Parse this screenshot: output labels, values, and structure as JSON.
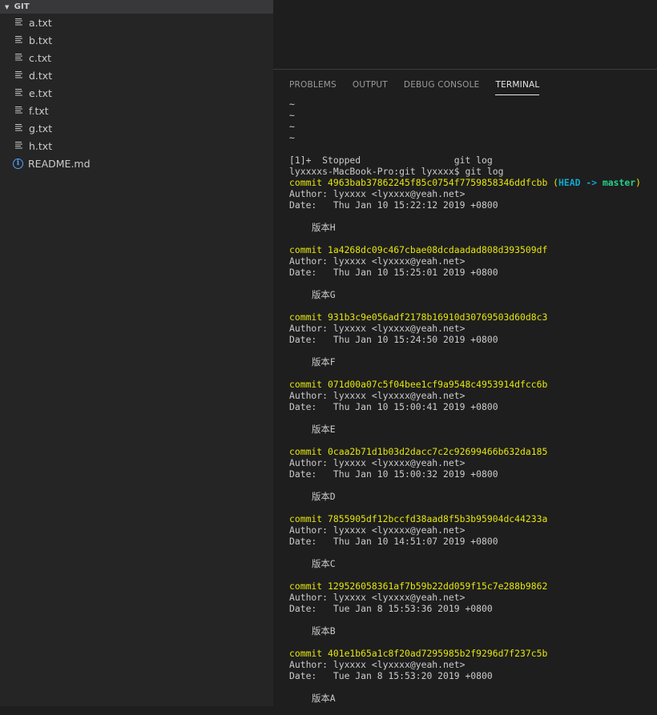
{
  "explorer": {
    "section_title": "GIT",
    "files": [
      {
        "name": "a.txt",
        "icon": "lines-file-icon"
      },
      {
        "name": "b.txt",
        "icon": "lines-file-icon"
      },
      {
        "name": "c.txt",
        "icon": "lines-file-icon"
      },
      {
        "name": "d.txt",
        "icon": "lines-file-icon"
      },
      {
        "name": "e.txt",
        "icon": "lines-file-icon"
      },
      {
        "name": "f.txt",
        "icon": "lines-file-icon"
      },
      {
        "name": "g.txt",
        "icon": "lines-file-icon"
      },
      {
        "name": "h.txt",
        "icon": "lines-file-icon"
      },
      {
        "name": "README.md",
        "icon": "info-icon"
      }
    ]
  },
  "panel": {
    "tabs": [
      "PROBLEMS",
      "OUTPUT",
      "DEBUG CONSOLE",
      "TERMINAL"
    ],
    "active_tab": "TERMINAL"
  },
  "terminal": {
    "tildes": [
      "~",
      "~",
      "~",
      "~"
    ],
    "stopped_line": "[1]+  Stopped                 git log",
    "prompt_line": "lyxxxxs-MacBook-Pro:git lyxxxx$ git log",
    "commits": [
      {
        "commit": "commit 4963bab37862245f85c0754f7759858346ddfcbb",
        "head": "HEAD ->",
        "branch": "master",
        "author": "Author: lyxxxx <lyxxxx@yeah.net>",
        "date": "Date:   Thu Jan 10 15:22:12 2019 +0800",
        "message": "版本H"
      },
      {
        "commit": "commit 1a4268dc09c467cbae08dcdaadad808d393509df",
        "author": "Author: lyxxxx <lyxxxx@yeah.net>",
        "date": "Date:   Thu Jan 10 15:25:01 2019 +0800",
        "message": "版本G"
      },
      {
        "commit": "commit 931b3c9e056adf2178b16910d30769503d60d8c3",
        "author": "Author: lyxxxx <lyxxxx@yeah.net>",
        "date": "Date:   Thu Jan 10 15:24:50 2019 +0800",
        "message": "版本F"
      },
      {
        "commit": "commit 071d00a07c5f04bee1cf9a9548c4953914dfcc6b",
        "author": "Author: lyxxxx <lyxxxx@yeah.net>",
        "date": "Date:   Thu Jan 10 15:00:41 2019 +0800",
        "message": "版本E"
      },
      {
        "commit": "commit 0caa2b71d1b03d2dacc7c2c92699466b632da185",
        "author": "Author: lyxxxx <lyxxxx@yeah.net>",
        "date": "Date:   Thu Jan 10 15:00:32 2019 +0800",
        "message": "版本D"
      },
      {
        "commit": "commit 7855905df12bccfd38aad8f5b3b95904dc44233a",
        "author": "Author: lyxxxx <lyxxxx@yeah.net>",
        "date": "Date:   Thu Jan 10 14:51:07 2019 +0800",
        "message": "版本C"
      },
      {
        "commit": "commit 129526058361af7b59b22dd059f15c7e288b9862",
        "author": "Author: lyxxxx <lyxxxx@yeah.net>",
        "date": "Date:   Tue Jan 8 15:53:36 2019 +0800",
        "message": "版本B"
      },
      {
        "commit": "commit 401e1b65a1c8f20ad7295985b2f9296d7f237c5b",
        "author": "Author: lyxxxx <lyxxxx@yeah.net>",
        "date": "Date:   Tue Jan 8 15:53:20 2019 +0800",
        "message": "版本A"
      }
    ]
  },
  "colors": {
    "commit_yellow": "#e5e510",
    "head_cyan": "#11a8cd",
    "branch_green": "#23d18b",
    "info_blue": "#4ea1ff"
  }
}
